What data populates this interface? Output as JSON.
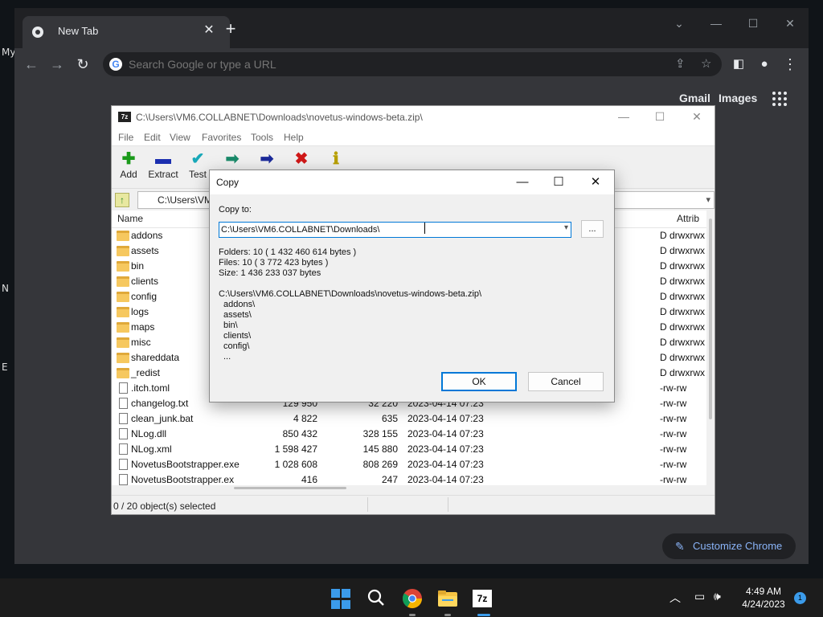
{
  "desktop": {
    "edge_labels": [
      "My",
      "N",
      "E"
    ]
  },
  "chrome": {
    "tab_title": "New Tab",
    "omnibox_placeholder": "Search Google or type a URL",
    "ntp_links": [
      "Gmail",
      "Images"
    ],
    "customize_label": "Customize Chrome"
  },
  "zip": {
    "title": "C:\\Users\\VM6.COLLABNET\\Downloads\\novetus-windows-beta.zip\\",
    "menu": [
      "File",
      "Edit",
      "View",
      "Favorites",
      "Tools",
      "Help"
    ],
    "tools": [
      {
        "label": "Add",
        "glyph": "✚",
        "color": "#1a9a1a"
      },
      {
        "label": "Extract",
        "glyph": "▬",
        "color": "#1b2fb0"
      },
      {
        "label": "Test",
        "glyph": "✔",
        "color": "#18a8b8"
      },
      {
        "label": "",
        "glyph": "➡",
        "color": "#1a8a6a"
      },
      {
        "label": "",
        "glyph": "➡",
        "color": "#1b2a9a"
      },
      {
        "label": "",
        "glyph": "✖",
        "color": "#d01818"
      },
      {
        "label": "",
        "glyph": "ℹ",
        "color": "#b8a000"
      }
    ],
    "address": "C:\\Users\\VM",
    "columns": {
      "name": "Name",
      "attrib": "Attrib"
    },
    "rows": [
      {
        "name": "addons",
        "type": "folder",
        "size": "",
        "packed": "",
        "modified": "",
        "attrib": "D drwxrwx"
      },
      {
        "name": "assets",
        "type": "folder",
        "size": "",
        "packed": "",
        "modified": "",
        "attrib": "D drwxrwx"
      },
      {
        "name": "bin",
        "type": "folder",
        "size": "",
        "packed": "",
        "modified": "",
        "attrib": "D drwxrwx"
      },
      {
        "name": "clients",
        "type": "folder",
        "size": "",
        "packed": "",
        "modified": "",
        "attrib": "D drwxrwx"
      },
      {
        "name": "config",
        "type": "folder",
        "size": "",
        "packed": "",
        "modified": "",
        "attrib": "D drwxrwx"
      },
      {
        "name": "logs",
        "type": "folder",
        "size": "",
        "packed": "",
        "modified": "",
        "attrib": "D drwxrwx"
      },
      {
        "name": "maps",
        "type": "folder",
        "size": "",
        "packed": "",
        "modified": "",
        "attrib": "D drwxrwx"
      },
      {
        "name": "misc",
        "type": "folder",
        "size": "",
        "packed": "",
        "modified": "",
        "attrib": "D drwxrwx"
      },
      {
        "name": "shareddata",
        "type": "folder",
        "size": "",
        "packed": "",
        "modified": "",
        "attrib": "D drwxrwx"
      },
      {
        "name": "_redist",
        "type": "folder",
        "size": "",
        "packed": "",
        "modified": "",
        "attrib": "D drwxrwx"
      },
      {
        "name": ".itch.toml",
        "type": "file",
        "size": "",
        "packed": "",
        "modified": "",
        "attrib": "-rw-rw"
      },
      {
        "name": "changelog.txt",
        "type": "file",
        "size": "129 950",
        "packed": "32 220",
        "modified": "2023-04-14 07:23",
        "attrib": "-rw-rw"
      },
      {
        "name": "clean_junk.bat",
        "type": "file",
        "size": "4 822",
        "packed": "635",
        "modified": "2023-04-14 07:23",
        "attrib": "-rw-rw"
      },
      {
        "name": "NLog.dll",
        "type": "file",
        "size": "850 432",
        "packed": "328 155",
        "modified": "2023-04-14 07:23",
        "attrib": "-rw-rw"
      },
      {
        "name": "NLog.xml",
        "type": "file",
        "size": "1 598 427",
        "packed": "145 880",
        "modified": "2023-04-14 07:23",
        "attrib": "-rw-rw"
      },
      {
        "name": "NovetusBootstrapper.exe",
        "type": "file",
        "size": "1 028 608",
        "packed": "808 269",
        "modified": "2023-04-14 07:23",
        "attrib": "-rw-rw"
      },
      {
        "name": "NovetusBootstrapper.ex",
        "type": "file",
        "size": "416",
        "packed": "247",
        "modified": "2023-04-14 07:23",
        "attrib": "-rw-rw"
      }
    ],
    "status": "0 / 20 object(s) selected"
  },
  "dialog": {
    "title": "Copy",
    "copy_to_label": "Copy to:",
    "path_value": "C:\\Users\\VM6.COLLABNET\\Downloads\\",
    "browse_label": "...",
    "folders": "Folders: 10    ( 1 432 460 614 bytes )",
    "files": "Files: 10    ( 3 772 423 bytes )",
    "size": "Size: 1 436 233 037 bytes",
    "source_path": "C:\\Users\\VM6.COLLABNET\\Downloads\\novetus-windows-beta.zip\\",
    "items": [
      "addons\\",
      "assets\\",
      "bin\\",
      "clients\\",
      "config\\",
      "..."
    ],
    "ok_label": "OK",
    "cancel_label": "Cancel"
  },
  "taskbar": {
    "time": "4:49 AM",
    "date": "4/24/2023",
    "notification_count": "1"
  }
}
